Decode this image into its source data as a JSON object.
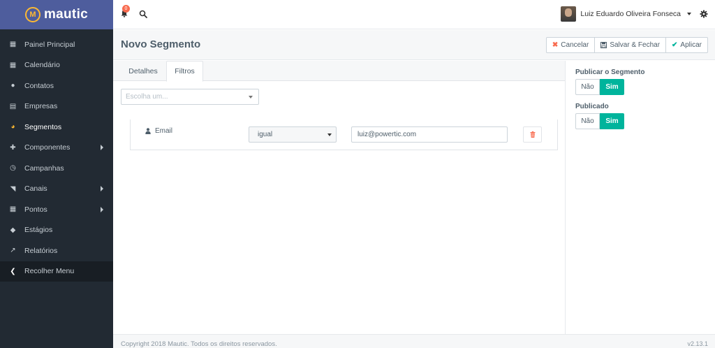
{
  "brand": {
    "name": "mautic",
    "logo_letter": "M"
  },
  "sidebar": {
    "items": [
      {
        "label": "Painel Principal",
        "icon": "dashboard-grid-icon",
        "glyph": "▦"
      },
      {
        "label": "Calendário",
        "icon": "calendar-icon",
        "glyph": "▦"
      },
      {
        "label": "Contatos",
        "icon": "user-icon",
        "glyph": "●"
      },
      {
        "label": "Empresas",
        "icon": "building-icon",
        "glyph": "▤"
      },
      {
        "label": "Segmentos",
        "icon": "pie-chart-icon",
        "glyph": "◕",
        "active": true
      },
      {
        "label": "Componentes",
        "icon": "puzzle-icon",
        "glyph": "✚",
        "has_submenu": true
      },
      {
        "label": "Campanhas",
        "icon": "clock-icon",
        "glyph": "◷"
      },
      {
        "label": "Canais",
        "icon": "rss-icon",
        "glyph": "◥",
        "has_submenu": true
      },
      {
        "label": "Pontos",
        "icon": "calculator-icon",
        "glyph": "▦",
        "has_submenu": true
      },
      {
        "label": "Estágios",
        "icon": "cubes-icon",
        "glyph": "◆"
      },
      {
        "label": "Relatórios",
        "icon": "line-chart-icon",
        "glyph": "↗"
      }
    ],
    "collapse_label": "Recolher Menu",
    "collapse_glyph": "❮"
  },
  "topbar": {
    "notification_count": "0",
    "user_name": "Luiz Eduardo Oliveira Fonseca"
  },
  "page": {
    "title": "Novo Segmento",
    "buttons": {
      "cancel": "Cancelar",
      "save_close": "Salvar & Fechar",
      "apply": "Aplicar"
    }
  },
  "tabs": [
    {
      "label": "Detalhes"
    },
    {
      "label": "Filtros",
      "active": true
    }
  ],
  "filters": {
    "add_placeholder": "Escolha um...",
    "rows": [
      {
        "field": "Email",
        "operator": "igual",
        "value": "luiz@powertic.com"
      }
    ]
  },
  "right_panel": {
    "publish_segment_label": "Publicar o Segmento",
    "published_label": "Publicado",
    "no_label": "Não",
    "yes_label": "Sim"
  },
  "footer": {
    "copyright": "Copyright 2018 Mautic. Todos os direitos reservados.",
    "version": "v2.13.1"
  },
  "colors": {
    "sidebar_bg": "#222a33",
    "brand_bg": "#4e5d9d",
    "accent_yellow": "#fdb933",
    "success_green": "#00b49c",
    "danger_red": "#f86b4f"
  }
}
